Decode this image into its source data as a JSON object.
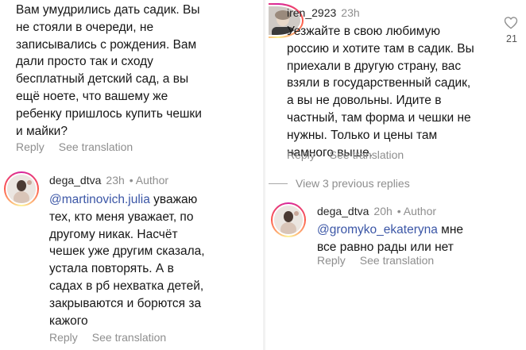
{
  "left": {
    "top_comment": {
      "text": "Вам умудрились дать садик. Вы\nне стояли в очереди, не\nзаписывались с рождения. Вам\nдали просто так и сходу\nбесплатный детский сад, а вы\nещё ноете, что вашему же\nребенку пришлось купить чешки\nи майки?",
      "reply_label": "Reply",
      "translate_label": "See translation"
    },
    "reply": {
      "username": "dega_dtva",
      "time": "23h",
      "author_label": "• Author",
      "mention": "@martinovich.julia",
      "text_first": " уважаю",
      "text_rest": "тех, кто меня уважает, по\nдругому никак. Насчёт\nчешек уже другим сказала,\nустала повторять. А в\nсадах в рб нехватка детей,\nзакрываются и борются за\nкажого",
      "reply_label": "Reply",
      "translate_label": "See translation"
    }
  },
  "right": {
    "comment": {
      "username": "iren_2923",
      "time": "23h",
      "text": "Уезжайте в свою любимую\nроссию и хотите там в садик. Вы\nприехали в другую страну, вас\nвзяли в государственный садик,\nа вы не довольны. Идите в\nчастный, там форма и чешки не\nнужны. Только и цены там\nнамного выше.",
      "reply_label": "Reply",
      "translate_label": "See translation",
      "likes": "21",
      "heart_icon": "heart-outline-icon"
    },
    "view_previous": "View 3 previous replies",
    "reply": {
      "username": "dega_dtva",
      "time": "20h",
      "author_label": "• Author",
      "mention": "@gromyko_ekateryna",
      "text_first": " мне",
      "text_rest": "все равно рады или нет",
      "reply_label": "Reply",
      "translate_label": "See translation"
    }
  }
}
